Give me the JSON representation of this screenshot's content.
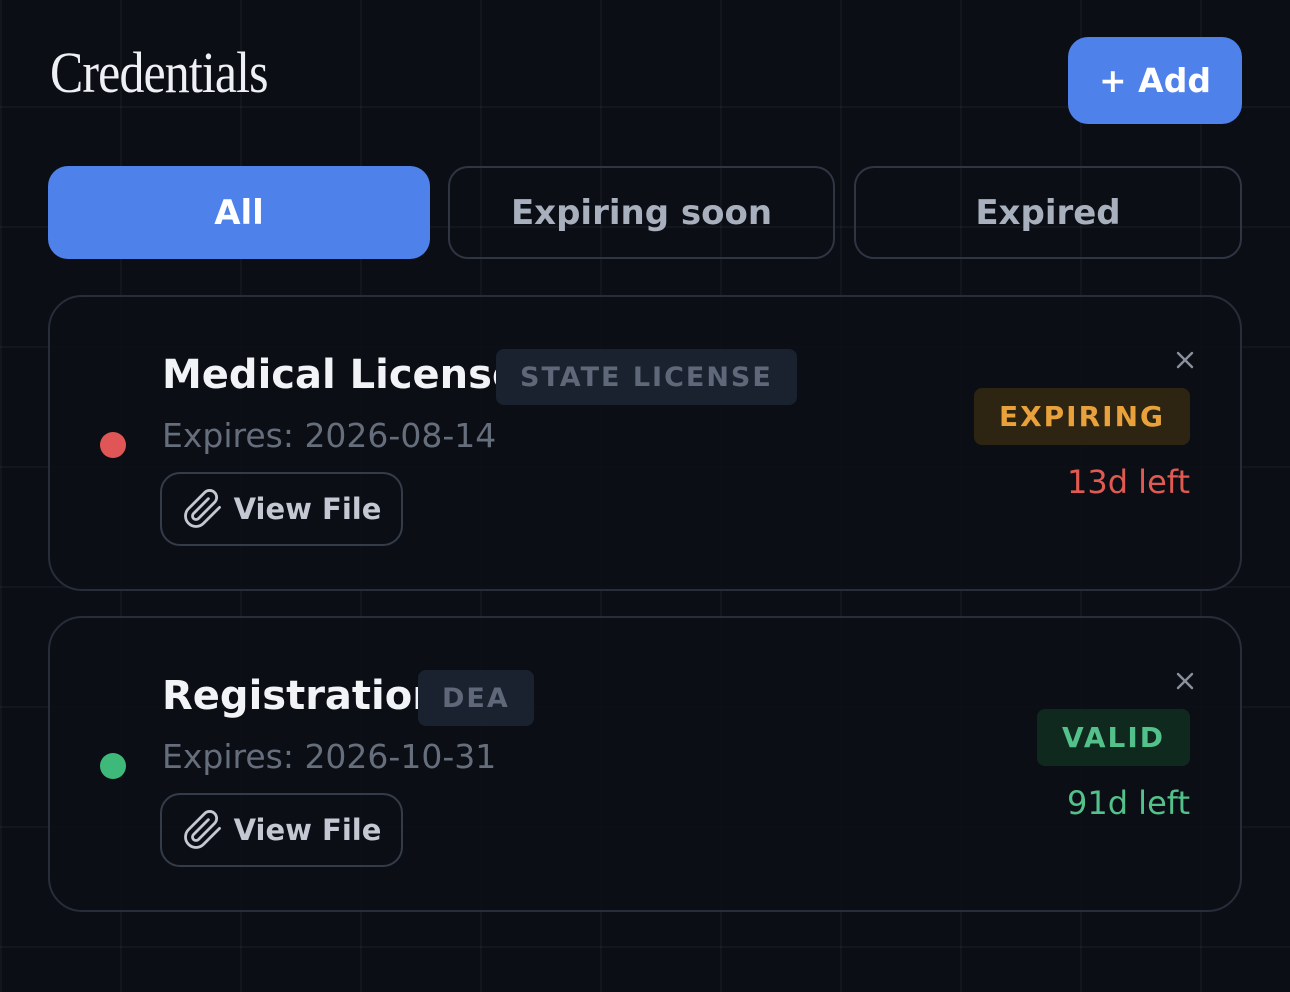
{
  "header": {
    "title": "Credentials",
    "add_label": "+ Add"
  },
  "tabs": [
    {
      "label": "All",
      "active": true
    },
    {
      "label": "Expiring soon",
      "active": false
    },
    {
      "label": "Expired",
      "active": false
    }
  ],
  "credentials": [
    {
      "title": "Medical License",
      "type": "STATE LICENSE",
      "expires": "Expires: 2026-08-14",
      "view_file_label": "View File",
      "status": "EXPIRING",
      "days_left": "13d left",
      "dot_color": "#e05555",
      "status_color": "#e9a23b",
      "status_bg": "#2e2412",
      "days_color": "#e05a52"
    },
    {
      "title": "Registration",
      "type": "DEA",
      "expires": "Expires: 2026-10-31",
      "view_file_label": "View File",
      "status": "VALID",
      "days_left": "91d left",
      "dot_color": "#3fb97a",
      "status_color": "#53c18a",
      "status_bg": "#10291f",
      "days_color": "#53c18a"
    }
  ],
  "icons": {
    "attachment": "paperclip-icon",
    "remove": "close-icon"
  },
  "colors": {
    "accent": "#4f81ea",
    "background": "#0b0e15"
  }
}
